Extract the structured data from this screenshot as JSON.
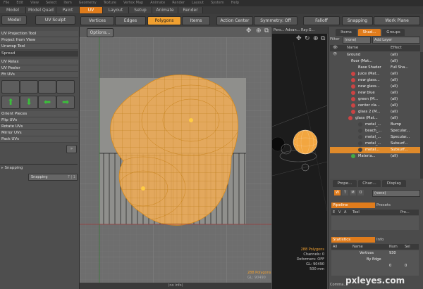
{
  "menubar": {
    "items": [
      "File",
      "Edit",
      "View",
      "Select",
      "Item",
      "Geometry",
      "Texture",
      "Vertex Map",
      "Animate",
      "Render",
      "Layout",
      "System",
      "Help"
    ]
  },
  "tabs": {
    "model": "Model",
    "model_quad": "Model Quad",
    "paint": "Paint",
    "uv": "UV",
    "layout": "Layout",
    "setup": "Setup",
    "animate": "Animate",
    "render": "Render"
  },
  "toolbar": {
    "vertices": "Vertices",
    "edges": "Edges",
    "polygons": "Polygons",
    "items": "Items",
    "action_center": "Action Center",
    "symmetry": "Symmetry: Off",
    "falloff": "Falloff",
    "snapping": "Snapping",
    "work_plane": "Work Plane"
  },
  "left": {
    "model_btn": "Model",
    "uv_sculpt_btn": "UV Sculpt",
    "tools": [
      "UV Projection Tool",
      "Project from View",
      "Unwrap Tool"
    ],
    "spread": "Spread",
    "relax": [
      "UV Relax",
      "UV Peeler",
      "Fit UVs"
    ],
    "ops": [
      "Orient Pieces",
      "Flip UVs",
      "Rotate UVs",
      "Mirror UVs",
      "Pack UVs"
    ],
    "snapping_head": "Snapping",
    "snapping_label": "Snapping",
    "snapping_value": "7 | 1"
  },
  "viewport": {
    "options": "Options...",
    "stats": "288 Polygons",
    "gl": "GL: 90490",
    "status": "(no info)"
  },
  "viewport3d": {
    "label": "Pers... Advan... Ray:G...",
    "polygons": "288 Polygons",
    "channels": "Channels: 0",
    "deformers": "Deformers: OFF",
    "gl": "GL: 90490",
    "distance": "500 mm"
  },
  "right": {
    "tabs": [
      "Items",
      "Shad...",
      "Groups"
    ],
    "filter": "Filter",
    "filter_value": "(none)",
    "add_layer": "Add Layer",
    "cols": [
      "Name",
      "Effect"
    ],
    "rows": [
      {
        "name": "Ground",
        "effect": "(all)"
      },
      {
        "name": "floor (Mat...",
        "effect": "(all)"
      },
      {
        "name": "Base Shader",
        "effect": "Full Sha..."
      },
      {
        "name": "juice (Mat...",
        "effect": "(all)"
      },
      {
        "name": "new glass...",
        "effect": "(all)"
      },
      {
        "name": "new glass...",
        "effect": "(all)"
      },
      {
        "name": "new blue",
        "effect": "(all)"
      },
      {
        "name": "green (M...",
        "effect": "(all)"
      },
      {
        "name": "center cla...",
        "effect": "(all)"
      },
      {
        "name": "glass 2 (M...",
        "effect": "(all)"
      },
      {
        "name": "glass (Mat...",
        "effect": "(all)"
      },
      {
        "name": "metal_...",
        "effect": "Bump"
      },
      {
        "name": "beach_...",
        "effect": "Specular..."
      },
      {
        "name": "metal_...",
        "effect": "Specular..."
      },
      {
        "name": "metal_...",
        "effect": "Subsurf..."
      },
      {
        "name": "metal...",
        "effect": "Subsurf..."
      },
      {
        "name": "Materia...",
        "effect": "(all)"
      }
    ],
    "lower_tabs": [
      "Prope...",
      "Chan...",
      "Display"
    ],
    "wtmo": [
      "W",
      "T",
      "M",
      "O"
    ],
    "wtmo_value": "(none)",
    "pipeline": "Pipeline",
    "presets": "Presets",
    "pipe_cols": [
      "E",
      "V",
      "A",
      "Tool",
      "Pre..."
    ],
    "statistics": "Statistics",
    "info": "Info",
    "stat_cols": [
      "All",
      "Name",
      "Num",
      "Sel"
    ],
    "stat_rows": [
      {
        "name": "Vertices",
        "num": "930",
        "sel": ""
      },
      {
        "name": "By Edge",
        "num": "",
        "sel": ""
      },
      {
        "name": "",
        "num": "0",
        "sel": "0"
      }
    ],
    "command": "Comma..."
  },
  "watermark": "pxleyes.com"
}
